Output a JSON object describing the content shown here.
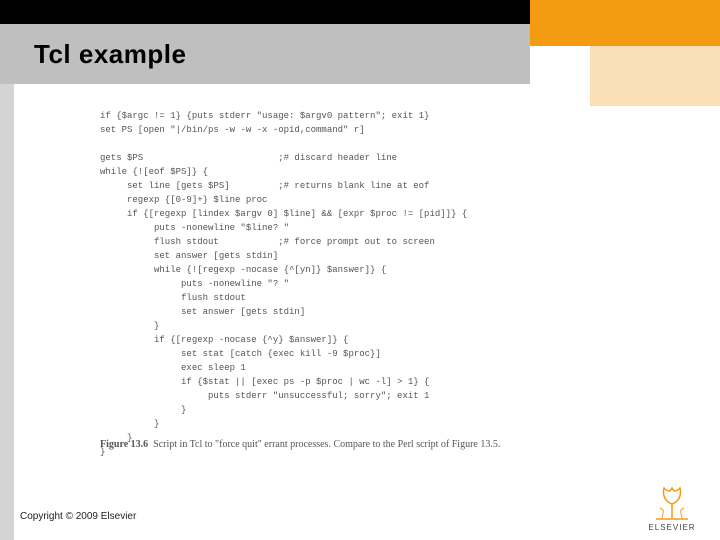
{
  "title": "Tcl example",
  "code_lines": [
    "if {$argc != 1} {puts stderr \"usage: $argv0 pattern\"; exit 1}",
    "set PS [open \"|/bin/ps -w -w -x -opid,command\" r]",
    "",
    "gets $PS                         ;# discard header line",
    "while {![eof $PS]} {",
    "     set line [gets $PS]         ;# returns blank line at eof",
    "     regexp {[0-9]+} $line proc",
    "     if {[regexp [lindex $argv 0] $line] && [expr $proc != [pid]]} {",
    "          puts -nonewline \"$line? \"",
    "          flush stdout           ;# force prompt out to screen",
    "          set answer [gets stdin]",
    "          while {![regexp -nocase {^[yn]} $answer]} {",
    "               puts -nonewline \"? \"",
    "               flush stdout",
    "               set answer [gets stdin]",
    "          }",
    "          if {[regexp -nocase {^y} $answer]} {",
    "               set stat [catch {exec kill -9 $proc}]",
    "               exec sleep 1",
    "               if {$stat || [exec ps -p $proc | wc -l] > 1} {",
    "                    puts stderr \"unsuccessful; sorry\"; exit 1",
    "               }",
    "          }",
    "     }",
    "}"
  ],
  "caption": {
    "fignum": "Figure 13.6",
    "text": "Script in Tcl to \"force quit\" errant processes.  Compare to the Perl script of Figure 13.5."
  },
  "footer": "Copyright © 2009 Elsevier",
  "logo_label": "ELSEVIER"
}
